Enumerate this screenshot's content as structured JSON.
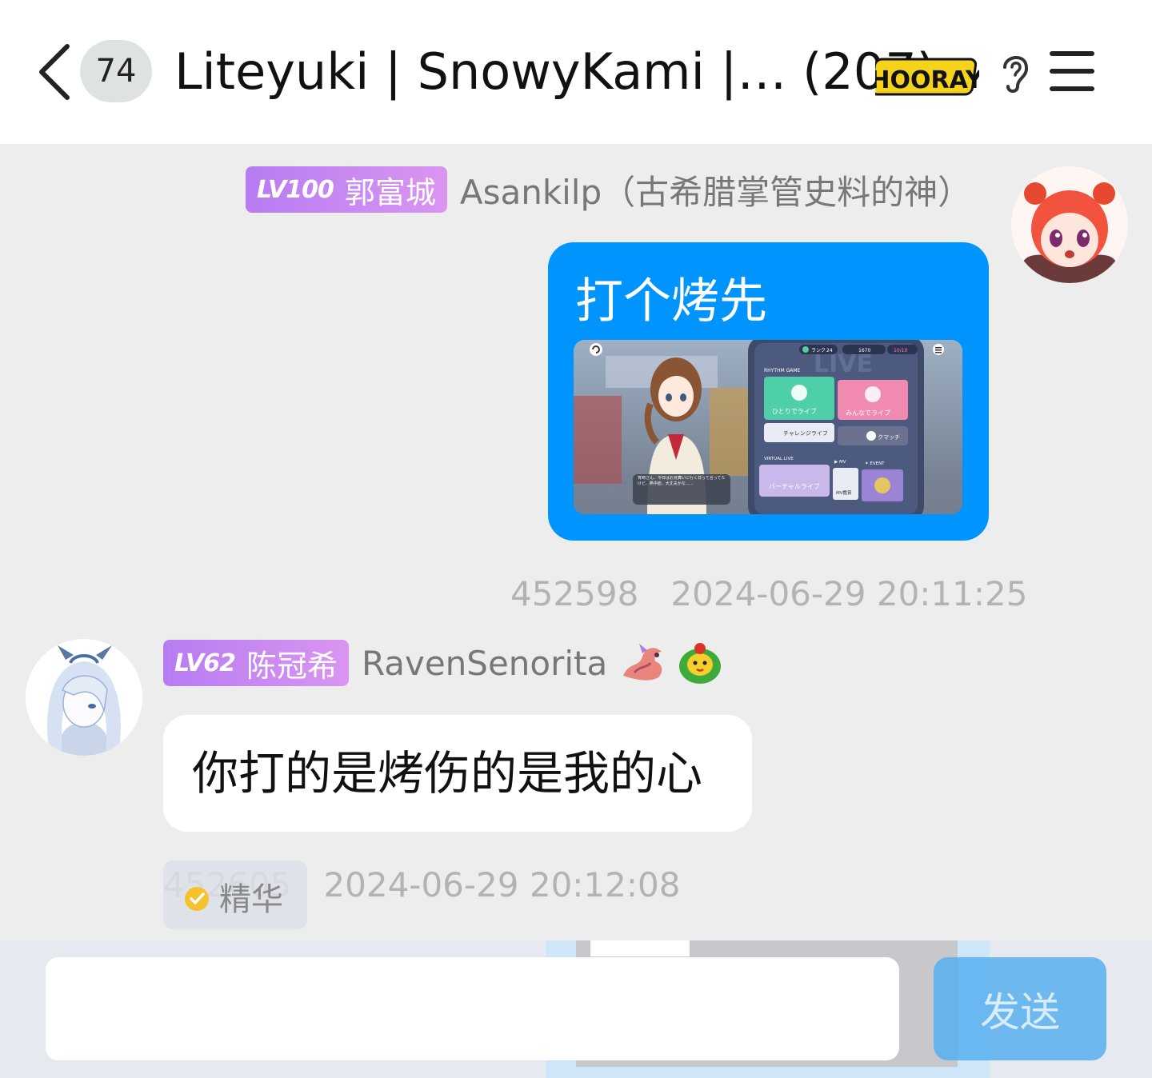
{
  "header": {
    "unread_count": "74",
    "title": "Liteyuki | SnowyKami |… (207)",
    "sticker_text": "HOORAY"
  },
  "messages": [
    {
      "side": "right",
      "level": "LV100",
      "title_name": "郭富城",
      "nickname": "Asankilp（古希腊掌管史料的神）",
      "text": "打个烤先",
      "msg_id": "452598",
      "time": "2024-06-29 20:11:25"
    },
    {
      "side": "left",
      "level": "LV62",
      "title_name": "陈冠希",
      "nickname": "RavenSenorita",
      "text": "你打的是烤伤的是我的心",
      "msg_id": "452605",
      "time": "2024-06-29 20:12:08",
      "tag": "精华"
    }
  ],
  "screenshot": {
    "rank_label": "ランク",
    "rank": "24",
    "coins": "1670",
    "energy": "10/10",
    "section_rhythm": "RHYTHM GAME",
    "solo_live": "ひとりでライブ",
    "multi_live": "みんなでライブ",
    "challenge_live": "チャレンジライフ",
    "rank_match": "クマッチ",
    "section_virtual": "VIRTUAL LIVE",
    "section_mv": "▶ MV",
    "section_event": "✦ EVENT",
    "virtual_live": "バーチャルライブ",
    "mv_label": "MV鑑賞",
    "live_watermark": "LIVE",
    "dialogue": "宵崎さん、今日はお見舞いに行く日って言ってたけど、熱中症、大丈夫かな……"
  },
  "input": {
    "placeholder": "",
    "send_label": "发送"
  },
  "colors": {
    "outgoing_bubble": "#0095fe",
    "incoming_bubble": "#ffffff",
    "level_badge": "#c389f2",
    "send_button": "#58aff0"
  }
}
